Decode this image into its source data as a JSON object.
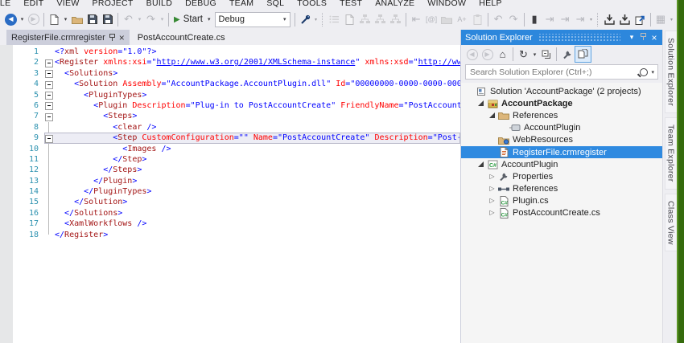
{
  "menu": {
    "items": [
      "FILE",
      "EDIT",
      "VIEW",
      "PROJECT",
      "BUILD",
      "DEBUG",
      "TEAM",
      "SQL",
      "TOOLS",
      "TEST",
      "ANALYZE",
      "WINDOW",
      "HELP"
    ]
  },
  "toolbar": {
    "start_label": "Start",
    "debug_value": "Debug",
    "items": [
      {
        "k": "circle",
        "dir": "left",
        "on": true,
        "name": "navigate-backward-icon"
      },
      {
        "k": "dd",
        "name": "navigate-backward-dropdown"
      },
      {
        "k": "circle",
        "dir": "right",
        "on": false,
        "name": "navigate-forward-icon"
      },
      {
        "k": "sep"
      },
      {
        "k": "page",
        "on": true,
        "name": "new-file-icon"
      },
      {
        "k": "dd",
        "name": "new-file-dropdown"
      },
      {
        "k": "folder",
        "on": true,
        "name": "open-file-icon"
      },
      {
        "k": "floppy",
        "on": true,
        "name": "save-icon"
      },
      {
        "k": "floppy",
        "on": true,
        "name": "save-all-icon"
      },
      {
        "k": "sep"
      },
      {
        "k": "glyph",
        "g": "↶",
        "on": false,
        "name": "undo-icon"
      },
      {
        "k": "dd",
        "on": false,
        "name": "undo-dropdown"
      },
      {
        "k": "glyph",
        "g": "↷",
        "on": false,
        "name": "redo-icon"
      },
      {
        "k": "dd",
        "on": false,
        "name": "redo-dropdown"
      },
      {
        "k": "sep"
      },
      {
        "k": "start",
        "name": "start-debug-button"
      },
      {
        "k": "combo",
        "name": "solution-configurations-combo"
      },
      {
        "k": "sep"
      },
      {
        "k": "key",
        "on": true,
        "name": "attach-icon"
      },
      {
        "k": "ovf",
        "name": "toolbar-overflow-icon"
      },
      {
        "k": "dotsep"
      },
      {
        "k": "list",
        "on": false,
        "name": "document-outline-icon"
      },
      {
        "k": "page",
        "on": false,
        "name": "document-icon"
      },
      {
        "k": "org",
        "on": false,
        "name": "schema-view-icon"
      },
      {
        "k": "org",
        "on": false,
        "name": "content-view-icon"
      },
      {
        "k": "org",
        "on": false,
        "name": "graph-view-icon"
      },
      {
        "k": "sep"
      },
      {
        "k": "glyph",
        "g": "⇤",
        "on": false,
        "name": "decrease-indent-icon"
      },
      {
        "k": "text",
        "g": "[@]",
        "on": false,
        "name": "insert-attribute-icon"
      },
      {
        "k": "folder",
        "on": false,
        "name": "group-nodes-icon"
      },
      {
        "k": "text",
        "g": "A+",
        "on": false,
        "name": "format-icon"
      },
      {
        "k": "clip",
        "on": false,
        "name": "paste-special-icon"
      },
      {
        "k": "sep"
      },
      {
        "k": "glyph",
        "g": "↶",
        "on": false,
        "name": "navigate-back-region-icon"
      },
      {
        "k": "glyph",
        "g": "↷",
        "on": false,
        "name": "navigate-forward-region-icon"
      },
      {
        "k": "sep"
      },
      {
        "k": "glyph",
        "g": "▮",
        "on": true,
        "name": "toggle-bookmark-icon"
      },
      {
        "k": "glyph",
        "g": "⇥",
        "on": false,
        "name": "previous-bookmark-icon"
      },
      {
        "k": "glyph",
        "g": "⇥",
        "on": false,
        "name": "next-bookmark-icon"
      },
      {
        "k": "glyph",
        "g": "⇥",
        "on": false,
        "name": "next-bookmark-folder-icon"
      },
      {
        "k": "ovf",
        "name": "bookmark-overflow-icon"
      },
      {
        "k": "dotsep"
      },
      {
        "k": "shelf",
        "on": true,
        "name": "save-collapsed-regions-icon"
      },
      {
        "k": "shelf",
        "on": true,
        "name": "restore-collapsed-regions-icon"
      },
      {
        "k": "import",
        "on": true,
        "name": "import-settings-icon"
      },
      {
        "k": "sep"
      },
      {
        "k": "glyph",
        "g": "▦",
        "on": false,
        "name": "table-grid-icon"
      },
      {
        "k": "ovf",
        "name": "overflow2-icon"
      }
    ]
  },
  "tabs": [
    {
      "label": "RegisterFile.crmregister",
      "active": true
    },
    {
      "label": "PostAccountCreate.cs",
      "active": false
    }
  ],
  "editor": {
    "highlight_line": 9,
    "lines": [
      {
        "num": 1,
        "fold": "none",
        "indent": 0,
        "tokens": [
          [
            "d",
            "<?"
          ],
          [
            "e",
            "xml"
          ],
          [
            "s",
            " "
          ],
          [
            "a",
            "version"
          ],
          [
            "d",
            "=\""
          ],
          [
            "v",
            "1.0"
          ],
          [
            "d",
            "\"?>"
          ]
        ]
      },
      {
        "num": 2,
        "fold": "box",
        "indent": 0,
        "tokens": [
          [
            "d",
            "<"
          ],
          [
            "e",
            "Register"
          ],
          [
            "s",
            " "
          ],
          [
            "a",
            "xmlns:xsi"
          ],
          [
            "d",
            "=\""
          ],
          [
            "u",
            "http://www.w3.org/2001/XMLSchema-instance"
          ],
          [
            "d",
            "\""
          ],
          [
            "s",
            " "
          ],
          [
            "a",
            "xmlns:xsd"
          ],
          [
            "d",
            "=\""
          ],
          [
            "u",
            "http://www"
          ]
        ]
      },
      {
        "num": 3,
        "fold": "box",
        "indent": 2,
        "tokens": [
          [
            "d",
            "<"
          ],
          [
            "e",
            "Solutions"
          ],
          [
            "d",
            ">"
          ]
        ]
      },
      {
        "num": 4,
        "fold": "box",
        "indent": 4,
        "tokens": [
          [
            "d",
            "<"
          ],
          [
            "e",
            "Solution"
          ],
          [
            "s",
            " "
          ],
          [
            "a",
            "Assembly"
          ],
          [
            "d",
            "=\""
          ],
          [
            "v",
            "AccountPackage.AccountPlugin.dll"
          ],
          [
            "d",
            "\""
          ],
          [
            "s",
            " "
          ],
          [
            "a",
            "Id"
          ],
          [
            "d",
            "=\""
          ],
          [
            "v",
            "00000000-0000-0000-0000"
          ]
        ]
      },
      {
        "num": 5,
        "fold": "box",
        "indent": 6,
        "tokens": [
          [
            "d",
            "<"
          ],
          [
            "e",
            "PluginTypes"
          ],
          [
            "d",
            ">"
          ]
        ]
      },
      {
        "num": 6,
        "fold": "box",
        "indent": 8,
        "tokens": [
          [
            "d",
            "<"
          ],
          [
            "e",
            "Plugin"
          ],
          [
            "s",
            " "
          ],
          [
            "a",
            "Description"
          ],
          [
            "d",
            "=\""
          ],
          [
            "v",
            "Plug-in to PostAccountCreate"
          ],
          [
            "d",
            "\""
          ],
          [
            "s",
            " "
          ],
          [
            "a",
            "FriendlyName"
          ],
          [
            "d",
            "=\""
          ],
          [
            "v",
            "PostAccountC"
          ]
        ]
      },
      {
        "num": 7,
        "fold": "box",
        "indent": 10,
        "tokens": [
          [
            "d",
            "<"
          ],
          [
            "e",
            "Steps"
          ],
          [
            "d",
            ">"
          ]
        ]
      },
      {
        "num": 8,
        "fold": "line",
        "indent": 12,
        "tokens": [
          [
            "d",
            "<"
          ],
          [
            "e",
            "clear"
          ],
          [
            "s",
            " "
          ],
          [
            "d",
            "/>"
          ]
        ]
      },
      {
        "num": 9,
        "fold": "box",
        "indent": 12,
        "tokens": [
          [
            "d",
            "<"
          ],
          [
            "e",
            "Step"
          ],
          [
            "s",
            " "
          ],
          [
            "a",
            "CustomConfiguration"
          ],
          [
            "d",
            "=\"\""
          ],
          [
            "s",
            " "
          ],
          [
            "a",
            "Name"
          ],
          [
            "d",
            "=\""
          ],
          [
            "v",
            "PostAccountCreate"
          ],
          [
            "d",
            "\""
          ],
          [
            "s",
            " "
          ],
          [
            "a",
            "Description"
          ],
          [
            "d",
            "=\""
          ],
          [
            "v",
            "Post-O"
          ]
        ]
      },
      {
        "num": 10,
        "fold": "line",
        "indent": 14,
        "tokens": [
          [
            "d",
            "<"
          ],
          [
            "e",
            "Images"
          ],
          [
            "s",
            " "
          ],
          [
            "d",
            "/>"
          ]
        ]
      },
      {
        "num": 11,
        "fold": "line",
        "indent": 12,
        "tokens": [
          [
            "d",
            "</"
          ],
          [
            "e",
            "Step"
          ],
          [
            "d",
            ">"
          ]
        ]
      },
      {
        "num": 12,
        "fold": "line",
        "indent": 10,
        "tokens": [
          [
            "d",
            "</"
          ],
          [
            "e",
            "Steps"
          ],
          [
            "d",
            ">"
          ]
        ]
      },
      {
        "num": 13,
        "fold": "line",
        "indent": 8,
        "tokens": [
          [
            "d",
            "</"
          ],
          [
            "e",
            "Plugin"
          ],
          [
            "d",
            ">"
          ]
        ]
      },
      {
        "num": 14,
        "fold": "line",
        "indent": 6,
        "tokens": [
          [
            "d",
            "</"
          ],
          [
            "e",
            "PluginTypes"
          ],
          [
            "d",
            ">"
          ]
        ]
      },
      {
        "num": 15,
        "fold": "line",
        "indent": 4,
        "tokens": [
          [
            "d",
            "</"
          ],
          [
            "e",
            "Solution"
          ],
          [
            "d",
            ">"
          ]
        ]
      },
      {
        "num": 16,
        "fold": "line",
        "indent": 2,
        "tokens": [
          [
            "d",
            "</"
          ],
          [
            "e",
            "Solutions"
          ],
          [
            "d",
            ">"
          ]
        ]
      },
      {
        "num": 17,
        "fold": "line",
        "indent": 2,
        "tokens": [
          [
            "d",
            "<"
          ],
          [
            "e",
            "XamlWorkflows"
          ],
          [
            "s",
            " "
          ],
          [
            "d",
            "/>"
          ]
        ]
      },
      {
        "num": 18,
        "fold": "end",
        "indent": 0,
        "tokens": [
          [
            "d",
            "</"
          ],
          [
            "e",
            "Register"
          ],
          [
            "d",
            ">"
          ]
        ]
      }
    ]
  },
  "solution_explorer": {
    "title": "Solution Explorer",
    "search_placeholder": "Search Solution Explorer (Ctrl+;)",
    "toolbar": [
      {
        "k": "circle",
        "dir": "left",
        "on": false,
        "name": "se-back-icon"
      },
      {
        "k": "circle",
        "dir": "right",
        "on": false,
        "name": "se-forward-icon"
      },
      {
        "k": "glyph",
        "g": "⌂",
        "on": true,
        "name": "home-icon"
      },
      {
        "k": "sep"
      },
      {
        "k": "glyph",
        "g": "↻",
        "on": true,
        "name": "sync-with-active-document-icon"
      },
      {
        "k": "dd",
        "name": "sync-dropdown"
      },
      {
        "k": "collapse",
        "on": true,
        "name": "collapse-all-icon"
      },
      {
        "k": "sep"
      },
      {
        "k": "wrench",
        "on": true,
        "name": "properties-icon"
      },
      {
        "k": "showall",
        "on": true,
        "name": "show-all-files-icon"
      }
    ],
    "tree": [
      {
        "label": "Solution 'AccountPackage' (2 projects)",
        "indent": 0,
        "icon": "solution",
        "arrow": "none"
      },
      {
        "label": "AccountPackage",
        "indent": 1,
        "icon": "package",
        "arrow": "expanded",
        "bold": true
      },
      {
        "label": "References",
        "indent": 2,
        "icon": "folder",
        "arrow": "expanded"
      },
      {
        "label": "AccountPlugin",
        "indent": 3,
        "icon": "assembly",
        "arrow": "none"
      },
      {
        "label": "WebResources",
        "indent": 2,
        "icon": "folder-web",
        "arrow": "none"
      },
      {
        "label": "RegisterFile.crmregister",
        "indent": 2,
        "icon": "file-register",
        "arrow": "none",
        "selected": true
      },
      {
        "label": "AccountPlugin",
        "indent": 1,
        "icon": "csproj",
        "arrow": "expanded"
      },
      {
        "label": "Properties",
        "indent": 2,
        "icon": "wrench",
        "arrow": "collapsed"
      },
      {
        "label": "References",
        "indent": 2,
        "icon": "references",
        "arrow": "collapsed"
      },
      {
        "label": "Plugin.cs",
        "indent": 2,
        "icon": "csfile",
        "arrow": "collapsed"
      },
      {
        "label": "PostAccountCreate.cs",
        "indent": 2,
        "icon": "csfile",
        "arrow": "collapsed"
      }
    ]
  },
  "side_tabs": [
    "Solution Explorer",
    "Team Explorer",
    "Class View"
  ],
  "colors": {
    "accent_blue": "#2D87DC",
    "selection_blue": "#2F8AE0",
    "chrome_background": "#EEEEF2",
    "active_tab": "#CCCEDB",
    "line_number": "#2B91AF",
    "xml_element": "#A31515",
    "xml_attribute": "#FF0000",
    "xml_value": "#0000FF",
    "green_edge_strip": "#356B0D"
  }
}
